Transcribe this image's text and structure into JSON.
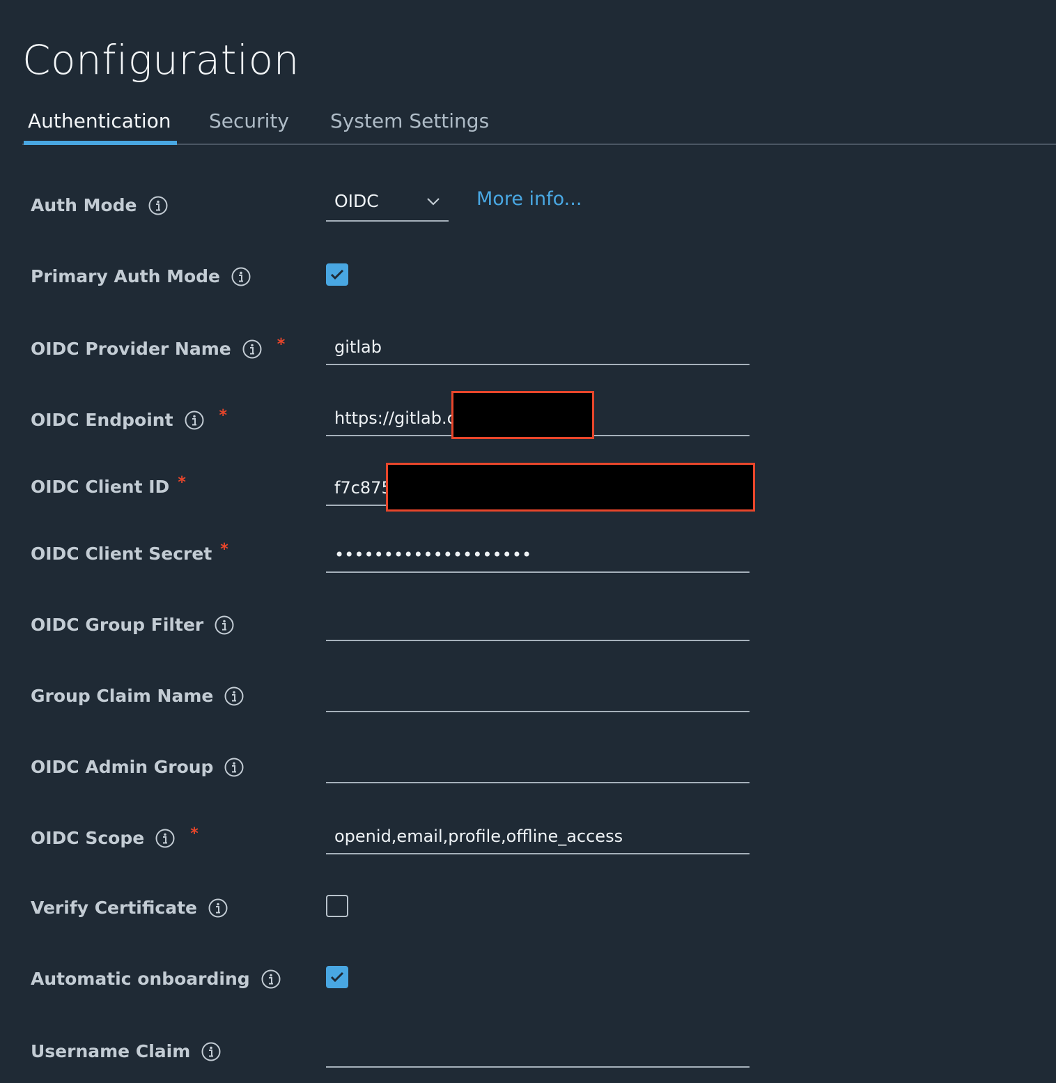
{
  "page": {
    "title": "Configuration"
  },
  "tabs": [
    {
      "label": "Authentication",
      "active": true
    },
    {
      "label": "Security",
      "active": false
    },
    {
      "label": "System Settings",
      "active": false
    }
  ],
  "auth_mode": {
    "label": "Auth Mode",
    "value": "OIDC",
    "link": "More info..."
  },
  "primary_auth_mode": {
    "label": "Primary Auth Mode",
    "checked": true
  },
  "oidc_provider_name": {
    "label": "OIDC Provider Name",
    "required_mark": "*",
    "value": "gitlab"
  },
  "oidc_endpoint": {
    "label": "OIDC Endpoint",
    "required_mark": "*",
    "value": "https://gitlab.c"
  },
  "oidc_client_id": {
    "label": "OIDC Client ID",
    "required_mark": "*",
    "value": "f7c875"
  },
  "oidc_client_secret": {
    "label": "OIDC Client Secret",
    "required_mark": "*",
    "value": "••••••••••••••••••••"
  },
  "oidc_group_filter": {
    "label": "OIDC Group Filter",
    "value": ""
  },
  "group_claim_name": {
    "label": "Group Claim Name",
    "value": ""
  },
  "oidc_admin_group": {
    "label": "OIDC Admin Group",
    "value": ""
  },
  "oidc_scope": {
    "label": "OIDC Scope",
    "required_mark": "*",
    "value": "openid,email,profile,offline_access"
  },
  "verify_certificate": {
    "label": "Verify Certificate",
    "checked": false
  },
  "automatic_onboarding": {
    "label": "Automatic onboarding",
    "checked": true
  },
  "username_claim": {
    "label": "Username Claim",
    "value": ""
  },
  "colors": {
    "background": "#1f2a35",
    "accent": "#49a7e2",
    "required": "#e8462b",
    "redaction": "#000000"
  },
  "icons": {
    "info": "info-circle-icon",
    "dropdown": "chevron-down-icon",
    "check": "check-icon"
  }
}
